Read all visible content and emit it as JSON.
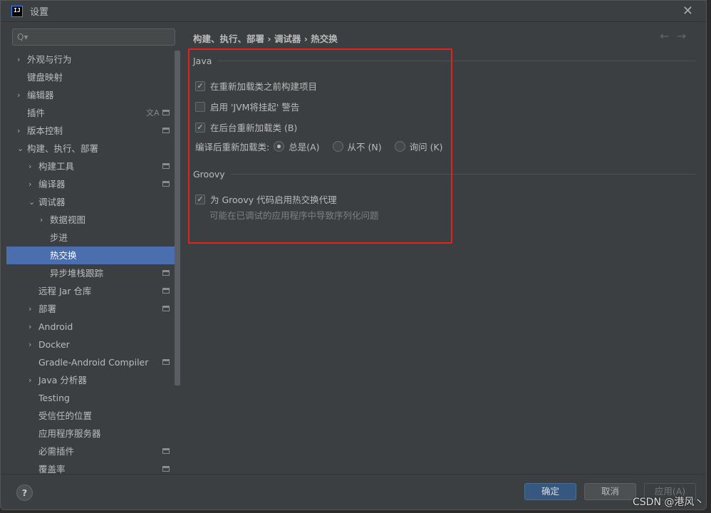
{
  "window": {
    "title": "设置",
    "close": "✕"
  },
  "search": {
    "placeholder": "Q▾"
  },
  "sidebar": {
    "items": [
      {
        "label": "外观与行为",
        "level": 0,
        "arrow": "›"
      },
      {
        "label": "键盘映射",
        "level": 0
      },
      {
        "label": "编辑器",
        "level": 0,
        "arrow": "›"
      },
      {
        "label": "插件",
        "level": 0,
        "box": true,
        "translate": "文A"
      },
      {
        "label": "版本控制",
        "level": 0,
        "arrow": "›",
        "box": true
      },
      {
        "label": "构建、执行、部署",
        "level": 0,
        "arrow": "⌄"
      },
      {
        "label": "构建工具",
        "level": 1,
        "arrow": "›",
        "box": true
      },
      {
        "label": "编译器",
        "level": 1,
        "arrow": "›",
        "box": true
      },
      {
        "label": "调试器",
        "level": 1,
        "arrow": "⌄"
      },
      {
        "label": "数据视图",
        "level": 2,
        "arrow": "›"
      },
      {
        "label": "步进",
        "level": 2
      },
      {
        "label": "热交换",
        "level": 2,
        "selected": true
      },
      {
        "label": "异步堆栈跟踪",
        "level": 2,
        "box": true
      },
      {
        "label": "远程 Jar 仓库",
        "level": 1,
        "box": true
      },
      {
        "label": "部署",
        "level": 1,
        "arrow": "›",
        "box": true
      },
      {
        "label": "Android",
        "level": 1,
        "arrow": "›"
      },
      {
        "label": "Docker",
        "level": 1,
        "arrow": "›"
      },
      {
        "label": "Gradle-Android Compiler",
        "level": 1,
        "box": true
      },
      {
        "label": "Java 分析器",
        "level": 1,
        "arrow": "›"
      },
      {
        "label": "Testing",
        "level": 1
      },
      {
        "label": "受信任的位置",
        "level": 1
      },
      {
        "label": "应用程序服务器",
        "level": 1
      },
      {
        "label": "必需插件",
        "level": 1,
        "box": true
      },
      {
        "label": "覆盖率",
        "level": 1,
        "box": true
      }
    ]
  },
  "breadcrumb": "构建、执行、部署 › 调试器 › 热交换",
  "nav": {
    "back": "←",
    "forward": "→"
  },
  "java": {
    "title": "Java",
    "build_before": {
      "label": "在重新加载类之前构建项目",
      "checked": true
    },
    "jvm_warn": {
      "label": "启用 'JVM将挂起' 警告",
      "checked": false
    },
    "bg_reload": {
      "label": "在后台重新加载类 (B)",
      "checked": true
    },
    "after_compile": {
      "label": "编译后重新加载类:",
      "options": [
        "总是(A)",
        "从不 (N)",
        "询问 (K)"
      ],
      "selected": "总是(A)"
    }
  },
  "groovy": {
    "title": "Groovy",
    "agent": {
      "label": "为 Groovy 代码启用热交换代理",
      "checked": true
    },
    "hint": "可能在已调试的应用程序中导致序列化问题"
  },
  "footer": {
    "help": "?",
    "ok": "确定",
    "cancel": "取消",
    "apply": "应用(A)"
  },
  "watermark": "CSDN @港风丶",
  "colors": {
    "selection": "#4b6eaf",
    "highlight_box": "#e5211c",
    "ok_button": "#365880"
  }
}
